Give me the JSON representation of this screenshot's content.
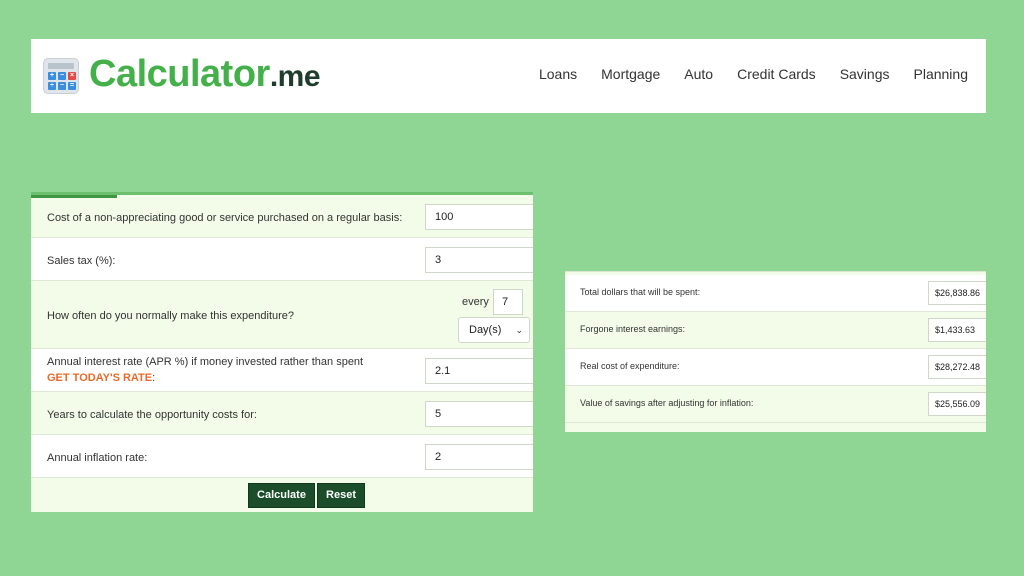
{
  "header": {
    "logo_main": "Calculator",
    "logo_suffix": ".me",
    "nav": [
      "Loans",
      "Mortgage",
      "Auto",
      "Credit Cards",
      "Savings",
      "Planning"
    ]
  },
  "logo_keys": [
    "+",
    "−",
    "×",
    "÷",
    "−",
    "="
  ],
  "form": {
    "cost_label": "Cost of a non-appreciating good or service purchased on a regular basis:",
    "cost_value": "100",
    "tax_label": "Sales tax (%):",
    "tax_value": "3",
    "freq_label": "How often do you normally make this expenditure?",
    "every_label": "every",
    "every_value": "7",
    "unit_value": "Day(s)",
    "rate_label": "Annual interest rate (APR %) if money invested rather than spent",
    "rate_link": "GET TODAY'S RATE",
    "rate_colon": ":",
    "rate_value": "2.1",
    "years_label": "Years to calculate the opportunity costs for:",
    "years_value": "5",
    "inflation_label": "Annual inflation rate:",
    "inflation_value": "2",
    "calculate_label": "Calculate",
    "reset_label": "Reset"
  },
  "results": {
    "total_label": "Total dollars that will be spent:",
    "total_value": "$26,838.86",
    "forgone_label": "Forgone interest earnings:",
    "forgone_value": "$1,433.63",
    "real_label": "Real cost of expenditure:",
    "real_value": "$28,272.48",
    "savings_label": "Value of savings after adjusting for inflation:",
    "savings_value": "$25,556.09"
  },
  "colors": {
    "background": "#8fd694",
    "brand_green": "#43b04a",
    "button": "#1b4d2b",
    "link_orange": "#e86a2a"
  }
}
